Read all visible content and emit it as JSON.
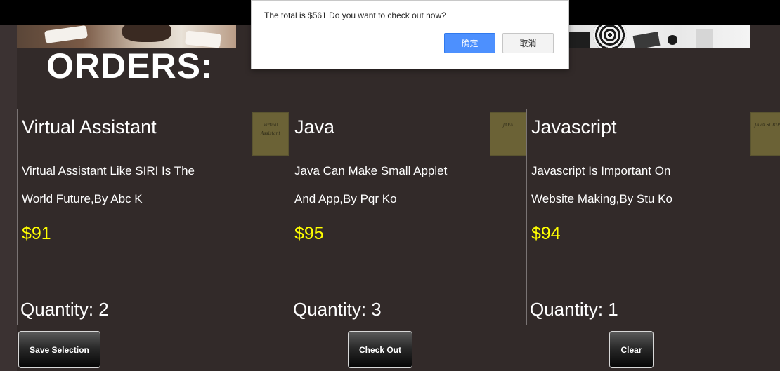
{
  "page": {
    "title": "ORDERS:"
  },
  "orders": [
    {
      "name": "Virtual Assistant",
      "thumbnail_text": "Virtual Assistant",
      "description_line1": "Virtual Assistant Like SIRI Is The",
      "description_line2": "World Future,By Abc K",
      "price": "$91",
      "quantity": "Quantity: 2"
    },
    {
      "name": "Java",
      "thumbnail_text": "JAVA",
      "description_line1": "Java Can Make Small Applet",
      "description_line2": "And App,By Pqr Ko",
      "price": "$95",
      "quantity": "Quantity: 3"
    },
    {
      "name": "Javascript",
      "thumbnail_text": "JAVA SCRIPT",
      "description_line1": "Javascript Is Important On",
      "description_line2": "Website Making,By Stu Ko",
      "price": "$94",
      "quantity": "Quantity: 1"
    }
  ],
  "actions": {
    "save_label": "Save Selection",
    "checkout_label": "Check Out",
    "clear_label": "Clear"
  },
  "dialog": {
    "message": "The total is $561 Do you want to check out now?",
    "ok_label": "确定",
    "cancel_label": "取消"
  },
  "colors": {
    "background": "#322a29",
    "price": "#ffff00",
    "dialog_primary": "#4d90fe",
    "thumbnail": "#6b6236"
  }
}
